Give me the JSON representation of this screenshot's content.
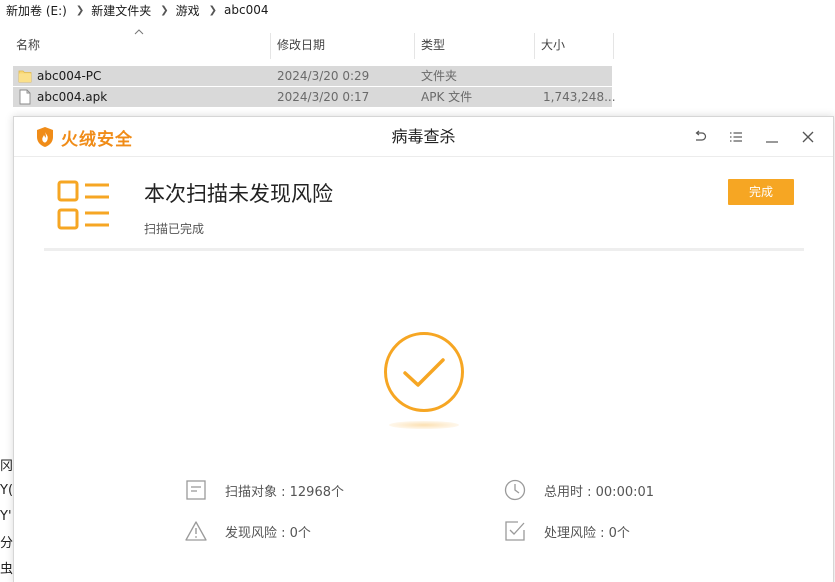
{
  "explorer": {
    "breadcrumb": [
      "新加卷 (E:)",
      "新建文件夹",
      "游戏",
      "abc004"
    ],
    "columns": {
      "name": "名称",
      "modified": "修改日期",
      "type": "类型",
      "size": "大小"
    },
    "files": [
      {
        "name": "abc004-PC",
        "modified": "2024/3/20 0:29",
        "type": "文件夹",
        "size": "",
        "icon": "folder-icon"
      },
      {
        "name": "abc004.apk",
        "modified": "2024/3/20 0:17",
        "type": "APK 文件",
        "size": "1,743,248...",
        "icon": "file-icon"
      }
    ],
    "left_edge_glyphs": [
      "冈",
      "Y(",
      "Y'",
      "分",
      "虫"
    ]
  },
  "dialog": {
    "brand": "火绒安全",
    "title": "病毒查杀",
    "summary_title": "本次扫描未发现风险",
    "summary_sub": "扫描已完成",
    "done_label": "完成",
    "stats": {
      "scanned": "扫描对象 : 12968个",
      "elapsed": "总用时 : 00:00:01",
      "risks_found": "发现风险 : 0个",
      "risks_handled": "处理风险 : 0个"
    },
    "icons": {
      "back": "back-icon",
      "menu": "menu-icon",
      "minimize": "minimize-icon",
      "close": "close-icon"
    },
    "colors": {
      "accent": "#f6a623",
      "brand": "#f08c18"
    }
  }
}
